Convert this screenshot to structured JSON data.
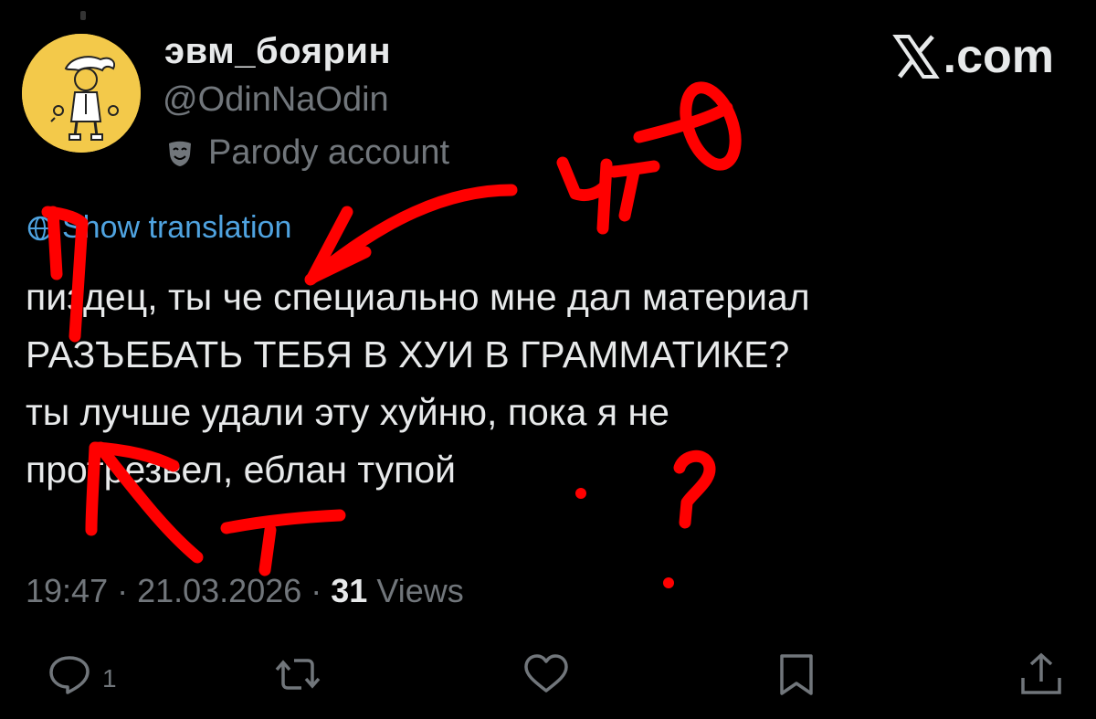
{
  "user": {
    "display_name": "эвм_боярин",
    "handle": "@OdinNaOdin",
    "parody_label": "Parody account",
    "avatar_icon": "cartoon-character-avatar"
  },
  "site": {
    "logo_text": ".com",
    "logo_icon": "x-logo-icon"
  },
  "translation": {
    "label": "Show translation",
    "icon": "globe-icon"
  },
  "tweet": {
    "lines": [
      "пиздец, ты че специально мне дал материал",
      "РАЗЪЕБАТЬ ТЕБЯ В ХУИ В ГРАММАТИКЕ?",
      "ты лучше удали эту хуйню, пока я не",
      "протрезвел, еблан тупой"
    ]
  },
  "meta": {
    "time": "19:47",
    "separator": "·",
    "date": "21.03.2026",
    "views_count": "31",
    "views_label": "Views"
  },
  "actions": {
    "reply_count": "1",
    "icons": [
      "reply-icon",
      "repost-icon",
      "like-icon",
      "bookmark-icon",
      "share-icon"
    ]
  },
  "annotations": {
    "color": "#ff0000",
    "texts": [
      "п",
      "чтО",
      "т",
      "?",
      "."
    ]
  },
  "colors": {
    "background": "#000000",
    "primary_text": "#e7e9ea",
    "secondary_text": "#71767b",
    "link": "#4fa3e0",
    "avatar_bg": "#f3c94a"
  }
}
